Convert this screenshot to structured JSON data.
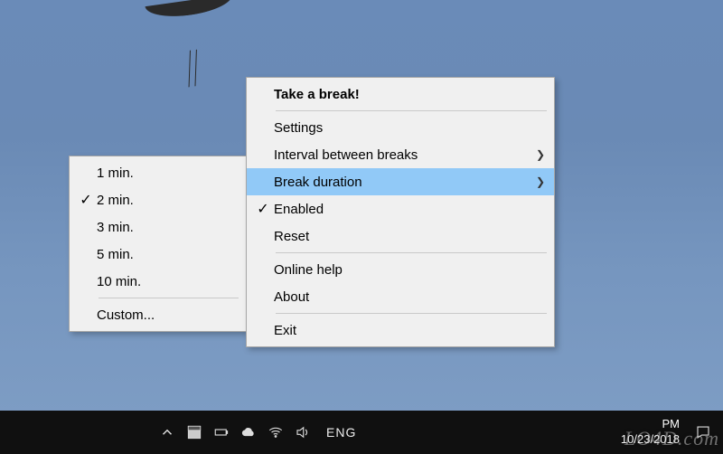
{
  "menu": {
    "title": "Take a break!",
    "settings": "Settings",
    "interval": "Interval between breaks",
    "duration": "Break duration",
    "enabled": "Enabled",
    "reset": "Reset",
    "help": "Online help",
    "about": "About",
    "exit": "Exit"
  },
  "submenu": {
    "items": [
      {
        "label": "1 min."
      },
      {
        "label": "2 min."
      },
      {
        "label": "3 min."
      },
      {
        "label": "5 min."
      },
      {
        "label": "10 min."
      }
    ],
    "custom": "Custom..."
  },
  "taskbar": {
    "lang": "ENG",
    "time_suffix": "PM",
    "date": "10/23/2018"
  },
  "watermark": "LO4D.com"
}
